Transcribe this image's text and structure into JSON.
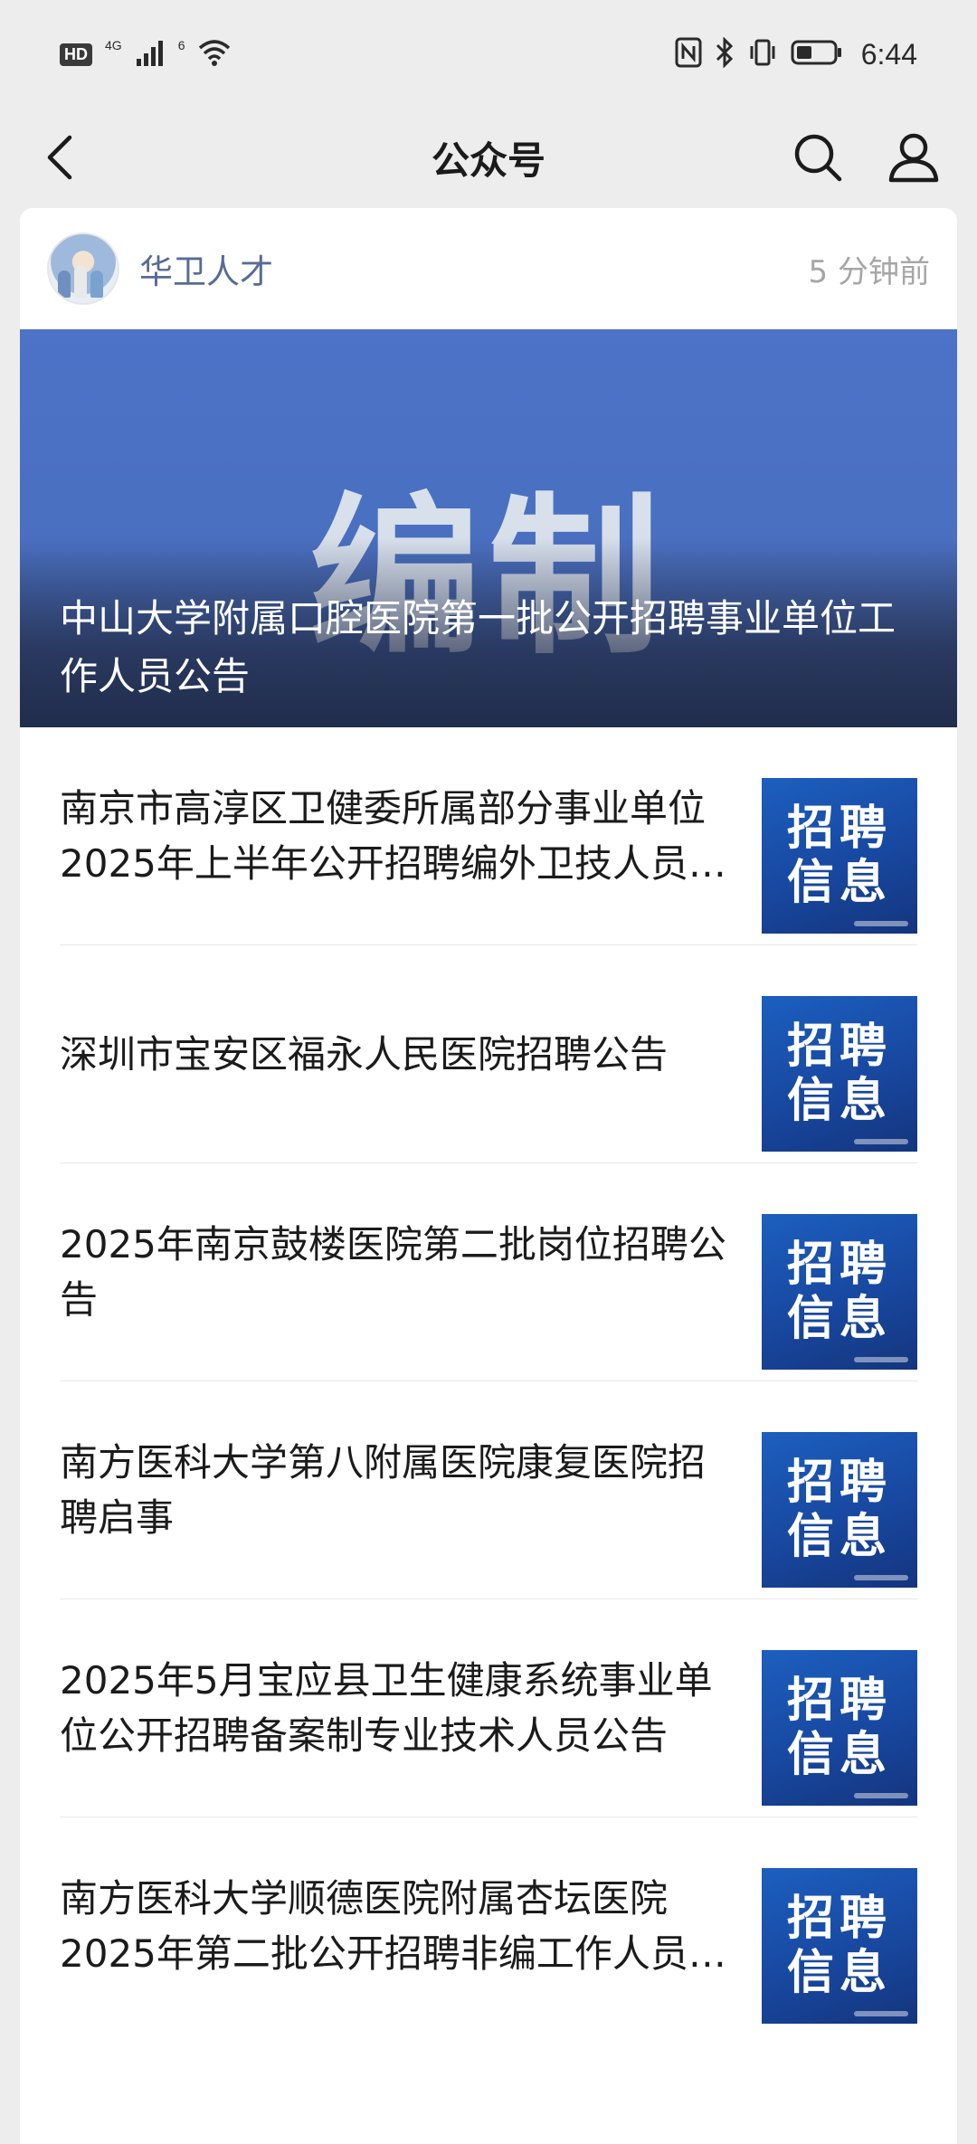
{
  "status_bar": {
    "hd": "HD",
    "net_label_1": "4G",
    "net_label_2": "6",
    "time": "6:44"
  },
  "nav": {
    "title": "公众号"
  },
  "account": {
    "name": "华卫人才",
    "time_ago": "5 分钟前"
  },
  "hero": {
    "big_text": "编制",
    "title": "中山大学附属口腔医院第一批公开招聘事业单位工作人员公告"
  },
  "thumb": {
    "line1": "招聘",
    "line2": "信息"
  },
  "articles": [
    {
      "title": "南京市高淳区卫健委所属部分事业单位2025年上半年公开招聘编外卫技人员公告"
    },
    {
      "title": "深圳市宝安区福永人民医院招聘公告"
    },
    {
      "title": "2025年南京鼓楼医院第二批岗位招聘公告"
    },
    {
      "title": "南方医科大学第八附属医院康复医院招聘启事"
    },
    {
      "title": "2025年5月宝应县卫生健康系统事业单位公开招聘备案制专业技术人员公告"
    },
    {
      "title": "南方医科大学顺德医院附属杏坛医院2025年第二批公开招聘非编工作人员公告"
    }
  ],
  "colors": {
    "account_name": "#576b95",
    "thumb_blue": "#1c5fbf",
    "hero_blue": "#4c73c8"
  }
}
